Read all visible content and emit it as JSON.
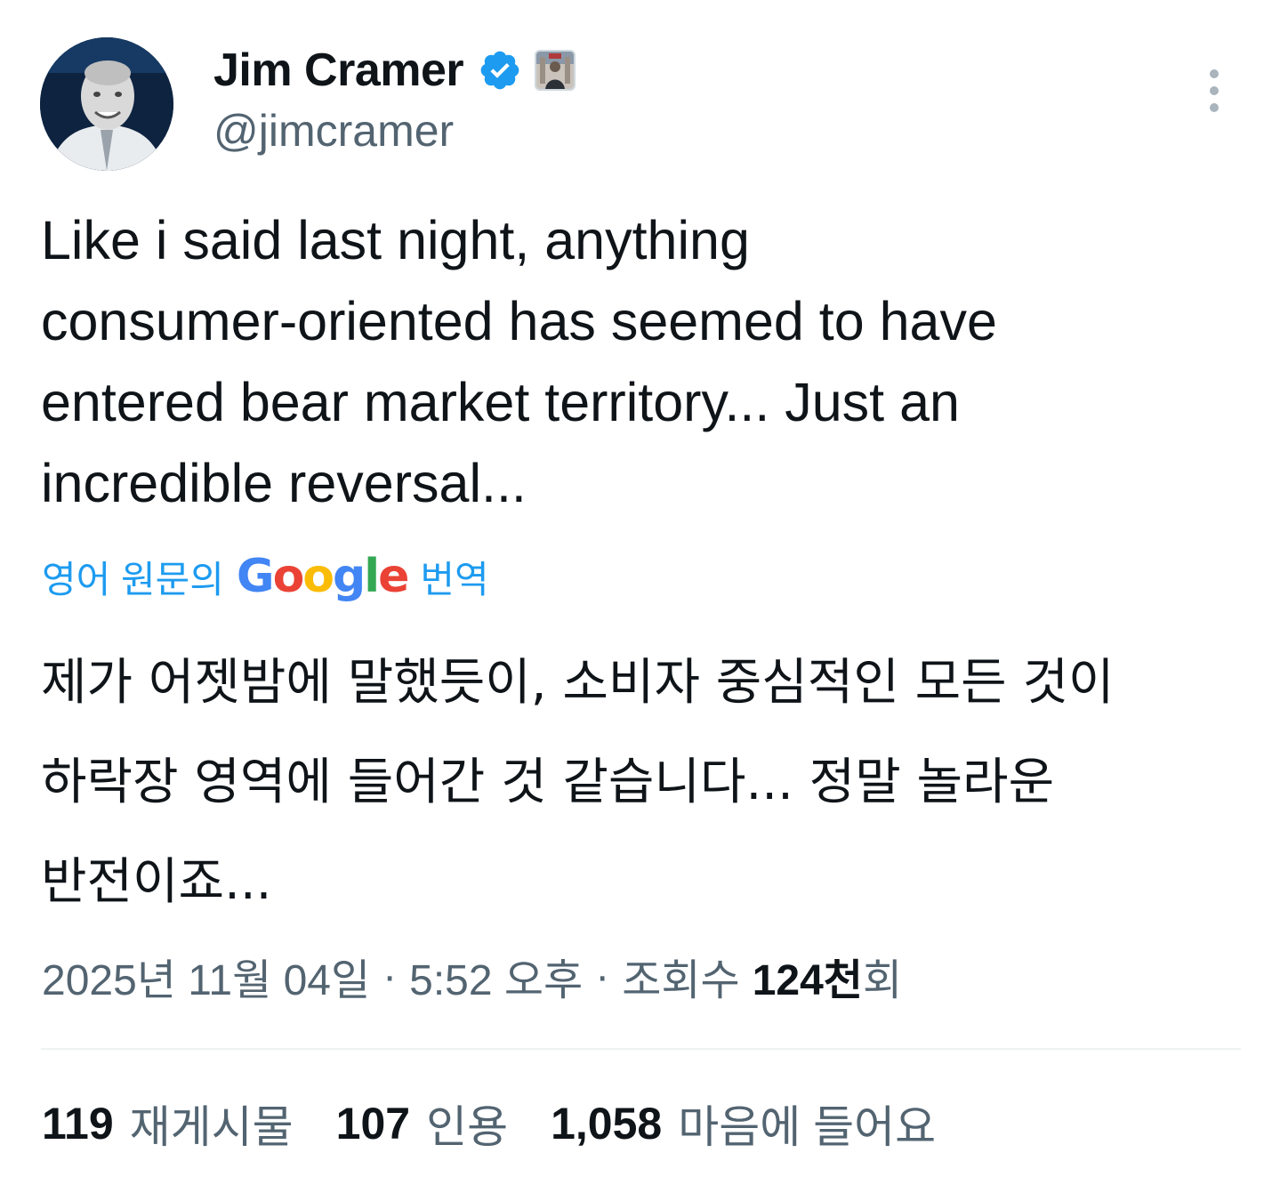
{
  "user": {
    "display_name": "Jim Cramer",
    "handle": "@jimcramer",
    "verified_icon": "verified-badge-icon",
    "affiliate_icon": "affiliate-badge-icon"
  },
  "tweet": {
    "text": "Like i said last night, anything\nconsumer-oriented has seemed to have\nentered bear market territory... Just an\nincredible reversal...",
    "translation": {
      "prefix": "영어 원문의",
      "brand_letters": [
        "G",
        "o",
        "o",
        "g",
        "l",
        "e"
      ],
      "suffix": "번역",
      "text": "제가 어젯밤에 말했듯이, 소비자 중심적인 모든 것이\n하락장 영역에 들어간 것 같습니다... 정말 놀라운\n반전이죠..."
    }
  },
  "meta": {
    "date": "2025년 11월 04일",
    "separator": "·",
    "time": "5:52 오후",
    "views_label_prefix": "조회수",
    "views_value": "124천",
    "views_label_suffix": "회"
  },
  "stats": [
    {
      "value": "119",
      "label": "재게시물"
    },
    {
      "value": "107",
      "label": "인용"
    },
    {
      "value": "1,058",
      "label": "마음에 들어요"
    }
  ],
  "colors": {
    "accent": "#1d9bf0",
    "text_primary": "#0f1419",
    "text_secondary": "#536471",
    "divider": "#eff3f4"
  }
}
